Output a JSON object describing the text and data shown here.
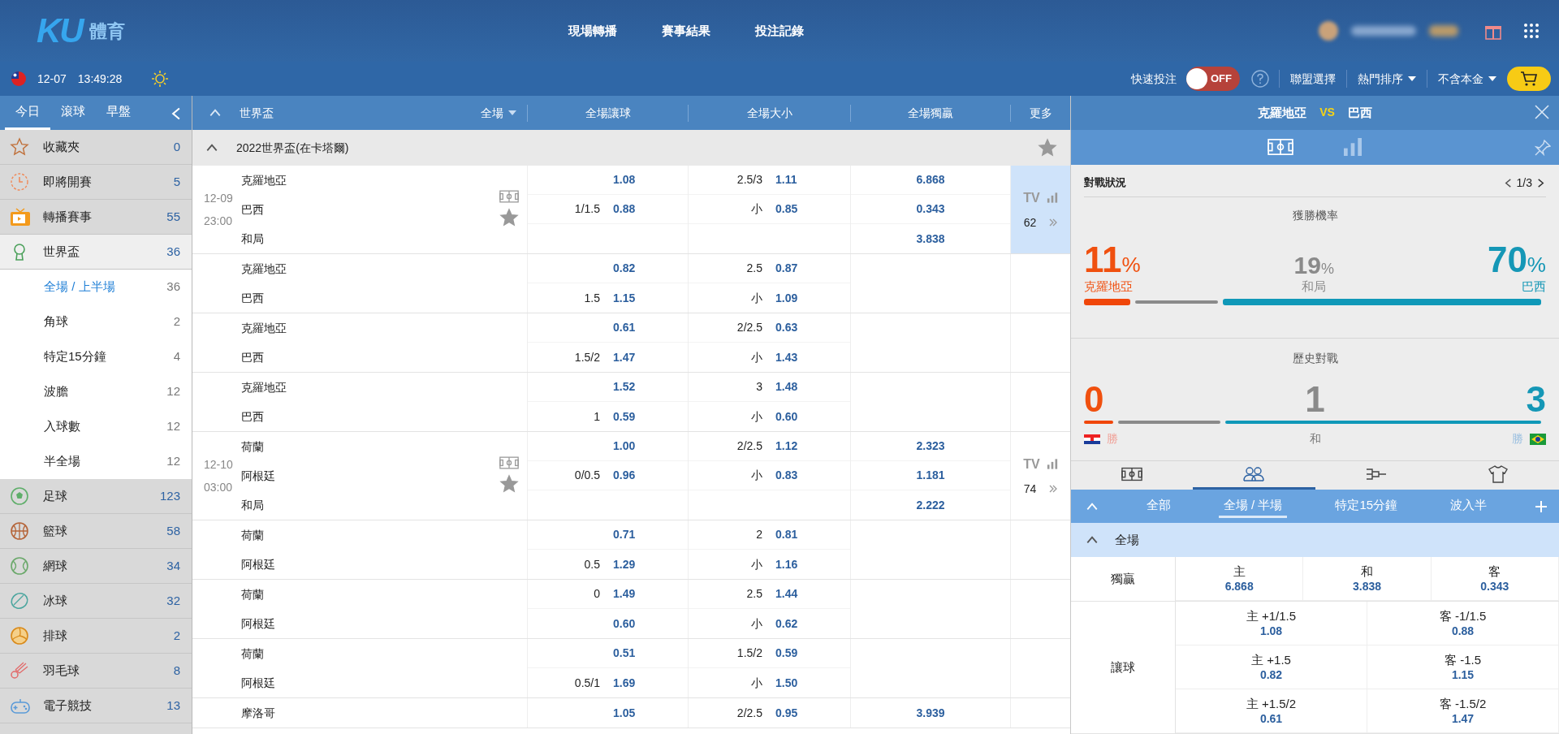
{
  "header": {
    "logo": {
      "mark": "KU",
      "text": "體育"
    },
    "nav": [
      "現場轉播",
      "賽事結果",
      "投注記錄"
    ]
  },
  "toolbar": {
    "date": "12-07",
    "time": "13:49:28",
    "quick_bet": {
      "label": "快速投注",
      "toggle": "OFF",
      "on": false
    },
    "menus": [
      {
        "label": "聯盟選擇",
        "dropdown": false
      },
      {
        "label": "熱門排序",
        "dropdown": true
      },
      {
        "label": "不含本金",
        "dropdown": true
      }
    ]
  },
  "sidebar": {
    "tabs": [
      {
        "label": "今日",
        "selected": true
      },
      {
        "label": "滾球",
        "selected": false
      },
      {
        "label": "早盤",
        "selected": false
      }
    ],
    "items": [
      {
        "label": "收藏夾",
        "count": "0"
      },
      {
        "label": "即將開賽",
        "count": "5"
      },
      {
        "label": "轉播賽事",
        "count": "55"
      },
      {
        "label": "世界盃",
        "count": "36",
        "expanded": true,
        "children": [
          {
            "label": "全場 / 上半場",
            "count": "36",
            "selected": true
          },
          {
            "label": "角球",
            "count": "2",
            "selected": false
          },
          {
            "label": "特定15分鐘",
            "count": "4",
            "selected": false
          },
          {
            "label": "波膽",
            "count": "12",
            "selected": false
          },
          {
            "label": "入球數",
            "count": "12",
            "selected": false
          },
          {
            "label": "半全場",
            "count": "12",
            "selected": false
          }
        ]
      },
      {
        "label": "足球",
        "count": "123",
        "expanded": false
      },
      {
        "label": "籃球",
        "count": "58",
        "expanded": false
      },
      {
        "label": "網球",
        "count": "34",
        "expanded": false
      },
      {
        "label": "冰球",
        "count": "32",
        "expanded": false
      },
      {
        "label": "排球",
        "count": "2",
        "expanded": false
      },
      {
        "label": "羽毛球",
        "count": "8",
        "expanded": false
      },
      {
        "label": "電子競技",
        "count": "13",
        "expanded": false
      }
    ]
  },
  "odds_table": {
    "title": "世界盃",
    "period": "全場",
    "columns": [
      "全場讓球",
      "全場大小",
      "全場獨贏",
      "更多"
    ],
    "league": "2022世界盃(在卡塔爾)",
    "matches": [
      {
        "date": "12-09",
        "time": "23:00",
        "selected": true,
        "tv": "TV",
        "more_count": "62",
        "blocks": [
          {
            "teams": [
              "克羅地亞",
              "巴西",
              "和局"
            ],
            "handicap": [
              {
                "odds": "1.08"
              },
              {
                "line": "1/1.5",
                "odds": "0.88"
              }
            ],
            "total": [
              {
                "line": "2.5/3",
                "odds": "1.11"
              },
              {
                "line": "小",
                "odds": "0.85"
              }
            ],
            "moneyline": [
              "6.868",
              "0.343",
              "3.838"
            ]
          },
          {
            "teams": [
              "克羅地亞",
              "巴西"
            ],
            "handicap": [
              {
                "odds": "0.82"
              },
              {
                "line": "1.5",
                "odds": "1.15"
              }
            ],
            "total": [
              {
                "line": "2.5",
                "odds": "0.87"
              },
              {
                "line": "小",
                "odds": "1.09"
              }
            ]
          },
          {
            "teams": [
              "克羅地亞",
              "巴西"
            ],
            "handicap": [
              {
                "odds": "0.61"
              },
              {
                "line": "1.5/2",
                "odds": "1.47"
              }
            ],
            "total": [
              {
                "line": "2/2.5",
                "odds": "0.63"
              },
              {
                "line": "小",
                "odds": "1.43"
              }
            ]
          },
          {
            "teams": [
              "克羅地亞",
              "巴西"
            ],
            "handicap": [
              {
                "odds": "1.52"
              },
              {
                "line": "1",
                "odds": "0.59"
              }
            ],
            "total": [
              {
                "line": "3",
                "odds": "1.48"
              },
              {
                "line": "小",
                "odds": "0.60"
              }
            ]
          }
        ]
      },
      {
        "date": "12-10",
        "time": "03:00",
        "selected": false,
        "tv": "TV",
        "more_count": "74",
        "blocks": [
          {
            "teams": [
              "荷蘭",
              "阿根廷",
              "和局"
            ],
            "handicap": [
              {
                "odds": "1.00"
              },
              {
                "line": "0/0.5",
                "odds": "0.96"
              }
            ],
            "total": [
              {
                "line": "2/2.5",
                "odds": "1.12"
              },
              {
                "line": "小",
                "odds": "0.83"
              }
            ],
            "moneyline": [
              "2.323",
              "1.181",
              "2.222"
            ]
          },
          {
            "teams": [
              "荷蘭",
              "阿根廷"
            ],
            "handicap": [
              {
                "odds": "0.71"
              },
              {
                "line": "0.5",
                "odds": "1.29"
              }
            ],
            "total": [
              {
                "line": "2",
                "odds": "0.81"
              },
              {
                "line": "小",
                "odds": "1.16"
              }
            ]
          },
          {
            "teams": [
              "荷蘭",
              "阿根廷"
            ],
            "handicap": [
              {
                "line": "0",
                "odds": "1.49"
              },
              {
                "odds": "0.60"
              }
            ],
            "total": [
              {
                "line": "2.5",
                "odds": "1.44"
              },
              {
                "line": "小",
                "odds": "0.62"
              }
            ]
          },
          {
            "teams": [
              "荷蘭",
              "阿根廷"
            ],
            "handicap": [
              {
                "odds": "0.51"
              },
              {
                "line": "0.5/1",
                "odds": "1.69"
              }
            ],
            "total": [
              {
                "line": "1.5/2",
                "odds": "0.59"
              },
              {
                "line": "小",
                "odds": "1.50"
              }
            ]
          }
        ]
      },
      {
        "blocks": [
          {
            "teams": [
              "摩洛哥"
            ],
            "handicap": [
              {
                "odds": "1.05"
              }
            ],
            "total": [
              {
                "line": "2/2.5",
                "odds": "0.95"
              }
            ],
            "moneyline": [
              "3.939"
            ]
          }
        ]
      }
    ]
  },
  "match_detail": {
    "home": "克羅地亞",
    "vs": "VS",
    "away": "巴西",
    "view_tabs": [
      {
        "selected": true
      },
      {
        "selected": false
      }
    ],
    "section_title": "對戰狀況",
    "pager": "1/3",
    "win_probability": {
      "title": "獲勝機率",
      "home": {
        "value": "11",
        "unit": "%",
        "label": "克羅地亞"
      },
      "draw": {
        "value": "19",
        "unit": "%",
        "label": "和局"
      },
      "away": {
        "value": "70",
        "unit": "%",
        "label": "巴西"
      }
    },
    "history": {
      "title": "歷史對戰",
      "home": {
        "value": "0",
        "label": "勝"
      },
      "draw": {
        "value": "1",
        "label": "和"
      },
      "away": {
        "value": "3",
        "label": "勝"
      }
    },
    "bottom_tabs": [
      {
        "selected": false
      },
      {
        "selected": true
      },
      {
        "selected": false
      },
      {
        "selected": false
      }
    ],
    "market_tabs": [
      {
        "label": "全部",
        "selected": false
      },
      {
        "label": "全場 / 半場",
        "selected": true
      },
      {
        "label": "特定15分鐘",
        "selected": false
      },
      {
        "label": "波入半",
        "selected": false
      }
    ],
    "market_group": {
      "title": "全場",
      "expanded": true
    },
    "markets": [
      {
        "name": "獨贏",
        "rows": [
          [
            {
              "label": "主",
              "odds": "6.868"
            },
            {
              "label": "和",
              "odds": "3.838"
            },
            {
              "label": "客",
              "odds": "0.343"
            }
          ]
        ]
      },
      {
        "name": "讓球",
        "rows": [
          [
            {
              "label": "主 +1/1.5",
              "odds": "1.08"
            },
            {
              "label": "客 -1/1.5",
              "odds": "0.88"
            }
          ],
          [
            {
              "label": "主 +1.5",
              "odds": "0.82"
            },
            {
              "label": "客 -1.5",
              "odds": "1.15"
            }
          ],
          [
            {
              "label": "主 +1.5/2",
              "odds": "0.61"
            },
            {
              "label": "客 -1.5/2",
              "odds": "1.47"
            }
          ]
        ]
      }
    ]
  }
}
